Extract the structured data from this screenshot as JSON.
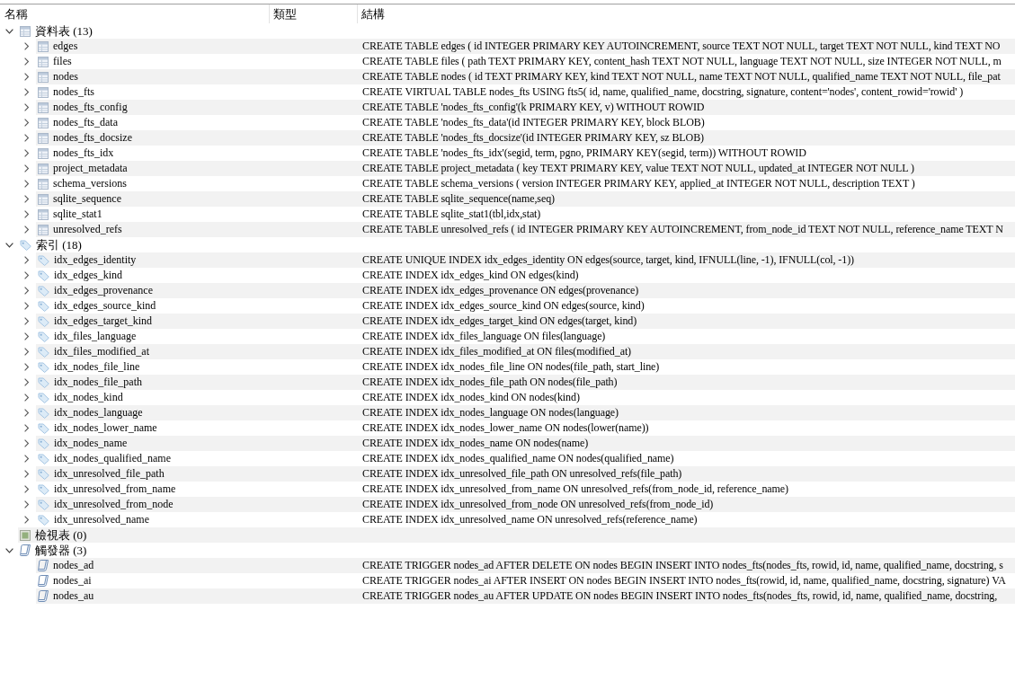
{
  "columns": [
    {
      "label": "名稱"
    },
    {
      "label": "類型"
    },
    {
      "label": "結構"
    }
  ],
  "tree": [
    {
      "label": "資料表 (13)",
      "kind": "table",
      "expanded": true,
      "children": [
        {
          "label": "edges",
          "expanded": false,
          "structure": "CREATE TABLE edges ( id INTEGER PRIMARY KEY AUTOINCREMENT, source TEXT NOT NULL, target TEXT NOT NULL, kind TEXT NO"
        },
        {
          "label": "files",
          "expanded": false,
          "structure": "CREATE TABLE files ( path TEXT PRIMARY KEY, content_hash TEXT NOT NULL, language TEXT NOT NULL, size INTEGER NOT NULL, m"
        },
        {
          "label": "nodes",
          "expanded": false,
          "structure": "CREATE TABLE nodes ( id TEXT PRIMARY KEY, kind TEXT NOT NULL, name TEXT NOT NULL, qualified_name TEXT NOT NULL, file_pat"
        },
        {
          "label": "nodes_fts",
          "expanded": false,
          "structure": "CREATE VIRTUAL TABLE nodes_fts USING fts5( id, name, qualified_name, docstring, signature, content='nodes', content_rowid='rowid' )"
        },
        {
          "label": "nodes_fts_config",
          "expanded": false,
          "structure": "CREATE TABLE 'nodes_fts_config'(k PRIMARY KEY, v) WITHOUT ROWID"
        },
        {
          "label": "nodes_fts_data",
          "expanded": false,
          "structure": "CREATE TABLE 'nodes_fts_data'(id INTEGER PRIMARY KEY, block BLOB)"
        },
        {
          "label": "nodes_fts_docsize",
          "expanded": false,
          "structure": "CREATE TABLE 'nodes_fts_docsize'(id INTEGER PRIMARY KEY, sz BLOB)"
        },
        {
          "label": "nodes_fts_idx",
          "expanded": false,
          "structure": "CREATE TABLE 'nodes_fts_idx'(segid, term, pgno, PRIMARY KEY(segid, term)) WITHOUT ROWID"
        },
        {
          "label": "project_metadata",
          "expanded": false,
          "structure": "CREATE TABLE project_metadata ( key TEXT PRIMARY KEY, value TEXT NOT NULL, updated_at INTEGER NOT NULL )"
        },
        {
          "label": "schema_versions",
          "expanded": false,
          "structure": "CREATE TABLE schema_versions ( version INTEGER PRIMARY KEY, applied_at INTEGER NOT NULL, description TEXT )"
        },
        {
          "label": "sqlite_sequence",
          "expanded": false,
          "structure": "CREATE TABLE sqlite_sequence(name,seq)"
        },
        {
          "label": "sqlite_stat1",
          "expanded": false,
          "structure": "CREATE TABLE sqlite_stat1(tbl,idx,stat)"
        },
        {
          "label": "unresolved_refs",
          "expanded": false,
          "structure": "CREATE TABLE unresolved_refs ( id INTEGER PRIMARY KEY AUTOINCREMENT, from_node_id TEXT NOT NULL, reference_name TEXT N"
        }
      ]
    },
    {
      "label": "索引 (18)",
      "kind": "index",
      "expanded": true,
      "children": [
        {
          "label": "idx_edges_identity",
          "expanded": false,
          "structure": "CREATE UNIQUE INDEX idx_edges_identity ON edges(source, target, kind, IFNULL(line, -1), IFNULL(col, -1))"
        },
        {
          "label": "idx_edges_kind",
          "expanded": false,
          "structure": "CREATE INDEX idx_edges_kind ON edges(kind)"
        },
        {
          "label": "idx_edges_provenance",
          "expanded": false,
          "structure": "CREATE INDEX idx_edges_provenance ON edges(provenance)"
        },
        {
          "label": "idx_edges_source_kind",
          "expanded": false,
          "structure": "CREATE INDEX idx_edges_source_kind ON edges(source, kind)"
        },
        {
          "label": "idx_edges_target_kind",
          "expanded": false,
          "structure": "CREATE INDEX idx_edges_target_kind ON edges(target, kind)"
        },
        {
          "label": "idx_files_language",
          "expanded": false,
          "structure": "CREATE INDEX idx_files_language ON files(language)"
        },
        {
          "label": "idx_files_modified_at",
          "expanded": false,
          "structure": "CREATE INDEX idx_files_modified_at ON files(modified_at)"
        },
        {
          "label": "idx_nodes_file_line",
          "expanded": false,
          "structure": "CREATE INDEX idx_nodes_file_line ON nodes(file_path, start_line)"
        },
        {
          "label": "idx_nodes_file_path",
          "expanded": false,
          "structure": "CREATE INDEX idx_nodes_file_path ON nodes(file_path)"
        },
        {
          "label": "idx_nodes_kind",
          "expanded": false,
          "structure": "CREATE INDEX idx_nodes_kind ON nodes(kind)"
        },
        {
          "label": "idx_nodes_language",
          "expanded": false,
          "structure": "CREATE INDEX idx_nodes_language ON nodes(language)"
        },
        {
          "label": "idx_nodes_lower_name",
          "expanded": false,
          "structure": "CREATE INDEX idx_nodes_lower_name ON nodes(lower(name))"
        },
        {
          "label": "idx_nodes_name",
          "expanded": false,
          "structure": "CREATE INDEX idx_nodes_name ON nodes(name)"
        },
        {
          "label": "idx_nodes_qualified_name",
          "expanded": false,
          "structure": "CREATE INDEX idx_nodes_qualified_name ON nodes(qualified_name)"
        },
        {
          "label": "idx_unresolved_file_path",
          "expanded": false,
          "structure": "CREATE INDEX idx_unresolved_file_path ON unresolved_refs(file_path)"
        },
        {
          "label": "idx_unresolved_from_name",
          "expanded": false,
          "structure": "CREATE INDEX idx_unresolved_from_name ON unresolved_refs(from_node_id, reference_name)"
        },
        {
          "label": "idx_unresolved_from_node",
          "expanded": false,
          "structure": "CREATE INDEX idx_unresolved_from_node ON unresolved_refs(from_node_id)"
        },
        {
          "label": "idx_unresolved_name",
          "expanded": false,
          "structure": "CREATE INDEX idx_unresolved_name ON unresolved_refs(reference_name)"
        }
      ]
    },
    {
      "label": "檢視表 (0)",
      "kind": "view"
    },
    {
      "label": "觸發器 (3)",
      "kind": "trigger",
      "expanded": true,
      "children": [
        {
          "label": "nodes_ad",
          "structure": "CREATE TRIGGER nodes_ad AFTER DELETE ON nodes BEGIN INSERT INTO nodes_fts(nodes_fts, rowid, id, name, qualified_name, docstring, s"
        },
        {
          "label": "nodes_ai",
          "structure": "CREATE TRIGGER nodes_ai AFTER INSERT ON nodes BEGIN INSERT INTO nodes_fts(rowid, id, name, qualified_name, docstring, signature) VA"
        },
        {
          "label": "nodes_au",
          "structure": "CREATE TRIGGER nodes_au AFTER UPDATE ON nodes BEGIN INSERT INTO nodes_fts(nodes_fts, rowid, id, name, qualified_name, docstring,"
        }
      ]
    }
  ]
}
